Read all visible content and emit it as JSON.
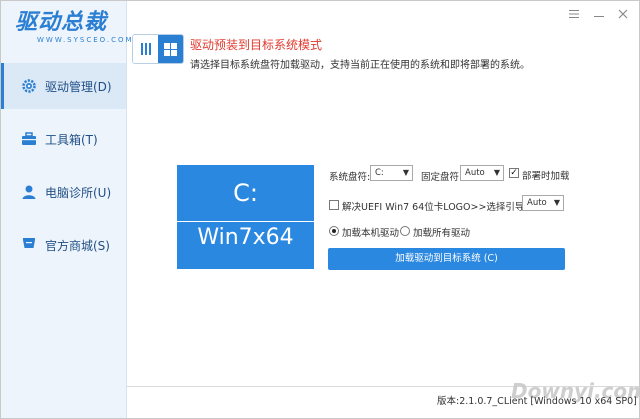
{
  "app": {
    "logo_text": "驱动总裁",
    "logo_sub": "WWW.SYSCEO.COM"
  },
  "sidebar": {
    "items": [
      {
        "label": "驱动管理(D)",
        "icon": "gear-icon",
        "active": true
      },
      {
        "label": "工具箱(T)",
        "icon": "toolbox-icon",
        "active": false
      },
      {
        "label": "电脑诊所(U)",
        "icon": "doctor-icon",
        "active": false
      },
      {
        "label": "官方商城(S)",
        "icon": "cart-icon",
        "active": false
      }
    ]
  },
  "window_controls": {
    "menu": "menu-icon",
    "minimize": "minimize-icon",
    "close": "close-icon"
  },
  "header": {
    "title": "驱动预装到目标系统模式",
    "description": "请选择目标系统盘符加载驱动，支持当前正在使用的系统和即将部署的系统。"
  },
  "drive": {
    "letter": "C:",
    "os": "Win7x64"
  },
  "form": {
    "system_drive_label": "系统盘符:",
    "system_drive_value": "C:",
    "fixed_drive_label": "固定盘符:",
    "fixed_drive_value": "Auto",
    "deploy_load_label": "部署时加载",
    "deploy_load_checked": true,
    "uefi_label": "解决UEFI Win7 64位卡LOGO>>选择引导盘符:",
    "uefi_checked": false,
    "boot_drive_value": "Auto",
    "radio_local": "加载本机驱动",
    "radio_all": "加载所有驱动",
    "load_button": "加载驱动到目标系统 (C)"
  },
  "footer": {
    "version": "版本:2.1.0.7_CLient [Windows 10 x64 SP0]",
    "watermark": "Downyi.com"
  },
  "colors": {
    "accent": "#2b88e0",
    "title_red": "#e03b2f",
    "sidebar_bg": "#eef4fb"
  }
}
